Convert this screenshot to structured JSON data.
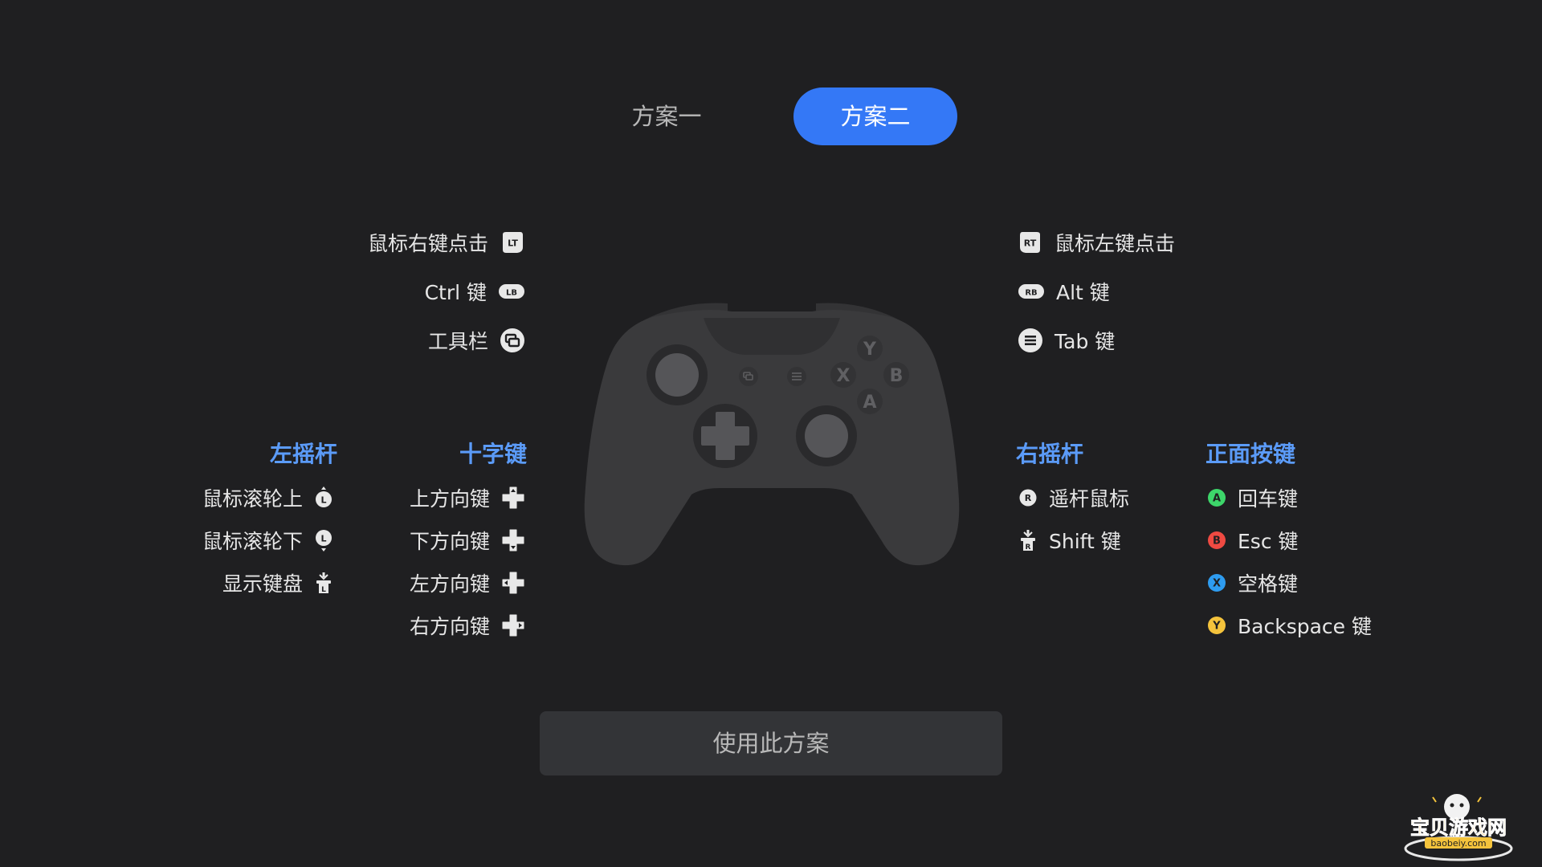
{
  "tabs": [
    {
      "label": "方案一",
      "selected": false
    },
    {
      "label": "方案二",
      "selected": true
    }
  ],
  "top_left": [
    {
      "label": "鼠标右键点击",
      "icon": "lt-trigger-icon",
      "badge": "LT"
    },
    {
      "label": "Ctrl 键",
      "icon": "lb-bumper-icon",
      "badge": "LB"
    },
    {
      "label": "工具栏",
      "icon": "view-button-icon"
    }
  ],
  "top_right": [
    {
      "label": "鼠标左键点击",
      "icon": "rt-trigger-icon",
      "badge": "RT"
    },
    {
      "label": "Alt 键",
      "icon": "rb-bumper-icon",
      "badge": "RB"
    },
    {
      "label": "Tab 键",
      "icon": "menu-button-icon"
    }
  ],
  "sections": {
    "left_stick": {
      "title": "左摇杆",
      "items": [
        {
          "label": "鼠标滚轮上",
          "icon": "left-stick-up-icon",
          "badge": "L"
        },
        {
          "label": "鼠标滚轮下",
          "icon": "left-stick-down-icon",
          "badge": "L"
        },
        {
          "label": "显示键盘",
          "icon": "left-stick-press-icon",
          "badge": "L"
        }
      ]
    },
    "dpad": {
      "title": "十字键",
      "items": [
        {
          "label": "上方向键",
          "icon": "dpad-up-icon"
        },
        {
          "label": "下方向键",
          "icon": "dpad-down-icon"
        },
        {
          "label": "左方向键",
          "icon": "dpad-left-icon"
        },
        {
          "label": "右方向键",
          "icon": "dpad-right-icon"
        }
      ]
    },
    "right_stick": {
      "title": "右摇杆",
      "items": [
        {
          "label": "遥杆鼠标",
          "icon": "right-stick-icon",
          "badge": "R"
        },
        {
          "label": "Shift 键",
          "icon": "right-stick-press-icon",
          "badge": "R"
        }
      ]
    },
    "face_buttons": {
      "title": "正面按键",
      "items": [
        {
          "label": "回车键",
          "icon": "a-button-icon",
          "badge": "A",
          "color": "#3dd66a"
        },
        {
          "label": "Esc 键",
          "icon": "b-button-icon",
          "badge": "B",
          "color": "#ef4a42"
        },
        {
          "label": "空格键",
          "icon": "x-button-icon",
          "badge": "X",
          "color": "#2e9cf0"
        },
        {
          "label": "Backspace 键",
          "icon": "y-button-icon",
          "badge": "Y",
          "color": "#f4c33c"
        }
      ]
    }
  },
  "controller": {
    "face_letters": [
      "Y",
      "X",
      "B",
      "A"
    ]
  },
  "apply_button": {
    "label": "使用此方案"
  },
  "watermark": {
    "title": "宝贝游戏网",
    "subtitle": "baobeiy.com"
  },
  "colors": {
    "background": "#1f1f21",
    "accent": "#3478f6",
    "heading": "#5b9bf8",
    "button_bg": "#333437",
    "controller_body": "#3a3a3c"
  }
}
